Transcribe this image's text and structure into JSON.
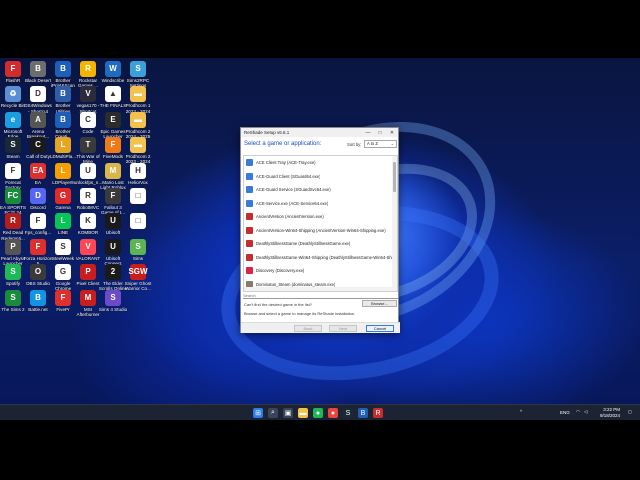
{
  "desktop_icons": [
    {
      "label": "FlashR",
      "bg": "#d12b2b",
      "glyph": "F"
    },
    {
      "label": "Black Desert",
      "bg": "#6d6d6d",
      "glyph": "B"
    },
    {
      "label": "Brother iPrint&Scan",
      "bg": "#1d5fb8",
      "glyph": "B"
    },
    {
      "label": "Rockstar Games ...",
      "bg": "#f5b400",
      "glyph": "R"
    },
    {
      "label": "Windscribe",
      "bg": "#1e6bbf",
      "glyph": "W"
    },
    {
      "label": "Sims2RPC Settings",
      "bg": "#3ca0d8",
      "glyph": "S"
    },
    {
      "label": "Recycle Bin",
      "bg": "#5a8ed6",
      "glyph": "♻"
    },
    {
      "label": "DS4Windows - Shortcut",
      "bg": "#ffffff",
      "glyph": "D"
    },
    {
      "label": "Brother Utilities",
      "bg": "#2f5ea8",
      "glyph": "B"
    },
    {
      "label": "vegas170 - Shortcut",
      "bg": "#2b2b3b",
      "glyph": "V"
    },
    {
      "label": "THE FINALS",
      "bg": "#ffffff",
      "glyph": "▲"
    },
    {
      "label": "Prodhcom 1 2023 - 2024",
      "bg": "#f2c14e",
      "glyph": "▬"
    },
    {
      "label": "Microsoft Edge",
      "bg": "#1b9de2",
      "glyph": "e"
    },
    {
      "label": "Arena Breakout...",
      "bg": "#555555",
      "glyph": "A"
    },
    {
      "label": "Brother Creati...",
      "bg": "#1d5fb8",
      "glyph": "B"
    },
    {
      "label": "Code",
      "bg": "#ffffff",
      "glyph": "C"
    },
    {
      "label": "Epic Games Launcher",
      "bg": "#2b2b2b",
      "glyph": "E"
    },
    {
      "label": "Prodhcom 2 2024 - 2025",
      "bg": "#f2c14e",
      "glyph": "▬"
    },
    {
      "label": "Steam",
      "bg": "#1b2838",
      "glyph": "S"
    },
    {
      "label": "Call of Duty",
      "bg": "#1a1a1a",
      "glyph": "C"
    },
    {
      "label": "LDMultiPla...",
      "bg": "#e5a623",
      "glyph": "L"
    },
    {
      "label": "This War of Mine",
      "bg": "#3a3a3a",
      "glyph": "T"
    },
    {
      "label": "FiveMods",
      "bg": "#f07a1a",
      "glyph": "F"
    },
    {
      "label": "Prodhcom 2 2023 - 2024",
      "bg": "#f2c14e",
      "glyph": "▬"
    },
    {
      "label": "Forecat Factory",
      "bg": "#ffffff",
      "glyph": "F"
    },
    {
      "label": "EA",
      "bg": "#e0302d",
      "glyph": "EA"
    },
    {
      "label": "LDPlayer9",
      "bg": "#f5a000",
      "glyph": "L"
    },
    {
      "label": "unlockfps_n...",
      "bg": "#ffffff",
      "glyph": "U"
    },
    {
      "label": "Mario Lost Light Roblox",
      "bg": "#d8b64a",
      "glyph": "M"
    },
    {
      "label": "HeliorVox",
      "bg": "#ffffff",
      "glyph": "H"
    },
    {
      "label": "EA SPORTS FC™ 24",
      "bg": "#1a8a3b",
      "glyph": "FC"
    },
    {
      "label": "Discord",
      "bg": "#5865f2",
      "glyph": "D"
    },
    {
      "label": "Garena",
      "bg": "#e02b2b",
      "glyph": "G"
    },
    {
      "label": "RobotMVC",
      "bg": "#ffffff",
      "glyph": "R"
    },
    {
      "label": "Fallout 3 Game of t...",
      "bg": "#3a3a3a",
      "glyph": "F"
    },
    {
      "label": "",
      "bg": "#ffffff",
      "glyph": "□"
    },
    {
      "label": "Red Dead Redempti...",
      "bg": "#b51d1d",
      "glyph": "R"
    },
    {
      "label": "Fps_config...",
      "bg": "#ffffff",
      "glyph": "F"
    },
    {
      "label": "LINE",
      "bg": "#06c755",
      "glyph": "L"
    },
    {
      "label": "KOMBOR",
      "bg": "#ffffff",
      "glyph": "K"
    },
    {
      "label": "Ubisoft",
      "bg": "#1a1a1a",
      "glyph": "U"
    },
    {
      "label": "",
      "bg": "#ffffff",
      "glyph": "□"
    },
    {
      "label": "Pearl Abyss Launcher",
      "bg": "#555555",
      "glyph": "P"
    },
    {
      "label": "Forza Horizon 5",
      "bg": "#e0302d",
      "glyph": "F"
    },
    {
      "label": "SteelWeek",
      "bg": "#ffffff",
      "glyph": "S"
    },
    {
      "label": "VALORANT",
      "bg": "#ff4655",
      "glyph": "V"
    },
    {
      "label": "Ubisoft Connect",
      "bg": "#1a1a1a",
      "glyph": "U"
    },
    {
      "label": "Sims",
      "bg": "#5ab552",
      "glyph": "S"
    },
    {
      "label": "Spotify",
      "bg": "#1db954",
      "glyph": "S"
    },
    {
      "label": "OBS Studio",
      "bg": "#3a3a3a",
      "glyph": "O"
    },
    {
      "label": "Google Chrome",
      "bg": "#ffffff",
      "glyph": "G"
    },
    {
      "label": "Pixel Client",
      "bg": "#c81e1e",
      "glyph": "P"
    },
    {
      "label": "The Elder Scrolls Online",
      "bg": "#1a1a1a",
      "glyph": "2"
    },
    {
      "label": "Sniper Ghost Warrior Co...",
      "bg": "#c81e1e",
      "glyph": "SGW"
    },
    {
      "label": "The Sims 2",
      "bg": "#1a8a3b",
      "glyph": "S"
    },
    {
      "label": "Battle.net",
      "bg": "#1493e0",
      "glyph": "B"
    },
    {
      "label": "FivePr",
      "bg": "#e0302d",
      "glyph": "F"
    },
    {
      "label": "MSI Afterburner",
      "bg": "#c81e1e",
      "glyph": "M"
    },
    {
      "label": "Sims 4 Studio",
      "bg": "#6c4ac8",
      "glyph": "S"
    }
  ],
  "window": {
    "title": "ReShade Setup v6.6.1",
    "minimize_glyph": "—",
    "maximize_glyph": "□",
    "close_glyph": "✕",
    "heading": "Select a game or application:",
    "sort_label": "Sort by:",
    "sort_value": "A to Z",
    "games": [
      {
        "label": "ACE Client Tray (ACE-Tray.exe)",
        "color": "#3b7bd8"
      },
      {
        "label": "ACE-Guard Client (SGuard64.exe)",
        "color": "#3b7bd8"
      },
      {
        "label": "ACE-Guard Service (SGuardSvc64.exe)",
        "color": "#3b7bd8"
      },
      {
        "label": "ACE-Service.exe (ACE-Service64.exe)",
        "color": "#3b7bd8"
      },
      {
        "label": "AncientVersion (AncientVersion.exe)",
        "color": "#c62d2d"
      },
      {
        "label": "AncientVersion-Win64-Shipping (AncientVersion-Win64-Shipping.exe)",
        "color": "#c62d2d"
      },
      {
        "label": "DeathlyStillnessGame (DeathlyStillnessGame.exe)",
        "color": "#c62d2d"
      },
      {
        "label": "DeathlyStillnessGame-Win64-Shipping (DeathlyStillnessGame-Win64-Shipp",
        "color": "#c62d2d"
      },
      {
        "label": "Discovery (Discovery.exe)",
        "color": "#d8254a"
      },
      {
        "label": "Dominatus_Steam (dominatus_steam.exe)",
        "color": "#8a7a6a"
      }
    ],
    "search_placeholder": "Search",
    "cant_find": "Can't find the desired game in the list?",
    "browse_label": "Browse...",
    "hint": "Browse and select a game to manage its ReShade installation.",
    "back_label": "Back",
    "next_label": "Next",
    "cancel_label": "Cancel"
  },
  "taskbar": {
    "icons": [
      {
        "name": "start-icon",
        "glyph": "⊞",
        "bg": "#2b7de9"
      },
      {
        "name": "search-icon",
        "glyph": "⌕",
        "bg": "#3a4458"
      },
      {
        "name": "task-view-icon",
        "glyph": "▣",
        "bg": "#3a4458"
      },
      {
        "name": "file-explorer-icon",
        "glyph": "▬",
        "bg": "#f2c14e"
      },
      {
        "name": "spotify-icon",
        "glyph": "●",
        "bg": "#1db954"
      },
      {
        "name": "chrome-icon",
        "glyph": "●",
        "bg": "#e8453c"
      },
      {
        "name": "steam-icon",
        "glyph": "S",
        "bg": "#1b2838"
      },
      {
        "name": "brother-icon",
        "glyph": "B",
        "bg": "#1d5fb8"
      },
      {
        "name": "reshade-icon",
        "glyph": "R",
        "bg": "#c62d2d"
      }
    ],
    "tray_lang": "ENG",
    "time": "3:22 PM",
    "date": "9/18/2024"
  }
}
